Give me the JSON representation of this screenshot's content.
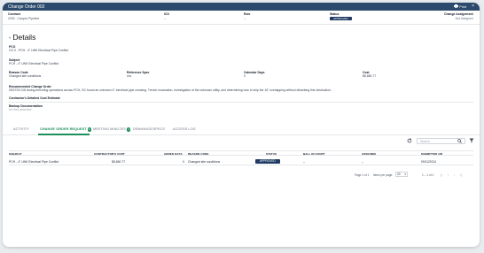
{
  "window": {
    "title": "Change Order 002",
    "print_label": "Print",
    "close_glyph": "×"
  },
  "meta": {
    "contract": {
      "label": "Contract",
      "value": "2205 - Canyon Pipeline"
    },
    "ico": {
      "label": "ICO",
      "value": "–"
    },
    "role": {
      "label": "Role",
      "value": "–"
    },
    "status": {
      "label": "Status",
      "value": "APPROVED"
    },
    "assignment": {
      "label": "Change Assignment",
      "value": "Not Assigned"
    }
  },
  "details": {
    "heading": "Details",
    "pco": {
      "label": "PCO",
      "value": "CO 0 - PCH - 4\" UNK Electrical Pipe Conflict"
    },
    "subject": {
      "label": "Subject",
      "value": "PCH - 4\" UNK Electrical Pipe Conflict"
    },
    "reason_code": {
      "label": "Reason Code",
      "value": "Changed site conditions"
    },
    "reference_spec": {
      "label": "Reference Spec",
      "value": "n/a"
    },
    "calendar_days": {
      "label": "Calendar Days",
      "value": "0"
    },
    "cost": {
      "label": "Cost",
      "value": "$8,680.77"
    },
    "recommended": {
      "label": "Recommended Change Order",
      "value": "09/27/24 DN during trenching operations across PCH, GC found an unknown 4\" electrical pipe crossing. Trench excavation, investigation of the unknown utility, and determining how to ship the 16\" overlapping without disturbing this obstruction."
    },
    "detailed_cost": {
      "label": "Contractor's Detailed Cost Estimate"
    },
    "backup": {
      "label": "Backup Documentation",
      "value": "No files attached"
    }
  },
  "tabs": [
    {
      "label": "ACTIVITY",
      "badge": ""
    },
    {
      "label": "CHANGE ORDER REQUEST",
      "badge": "1"
    },
    {
      "label": "MEETING MINUTES",
      "badge": "1"
    },
    {
      "label": "DRAWINGS/SPECS",
      "badge": ""
    },
    {
      "label": "ACCESS LOG",
      "badge": ""
    }
  ],
  "search": {
    "placeholder": "Search"
  },
  "table": {
    "headers": [
      "SUBJECT",
      "CONTRACTOR'S COST",
      "ADDED DAYS",
      "REASON CODE",
      "STATUS",
      "BALL IN COURT",
      "ASSIGNEE",
      "SUBMITTED ON"
    ],
    "rows": [
      {
        "subject": "PCH - 4\" UNK Electrical Pipe Conflict",
        "cost": "$8,680.77",
        "days": "0",
        "reason": "Changed site conditions",
        "status": "APPROVED",
        "ball": "–",
        "assignee": "–",
        "submitted": "09/12/2024"
      }
    ]
  },
  "pager": {
    "page_text": "Page 1 of 1",
    "items_label": "Items per page:",
    "per_page": "20",
    "range": "1 – 1 of 1"
  },
  "colors": {
    "titlebar": "#2c4a6b",
    "accent": "#1d8f5a",
    "status": "#1f3b63"
  }
}
